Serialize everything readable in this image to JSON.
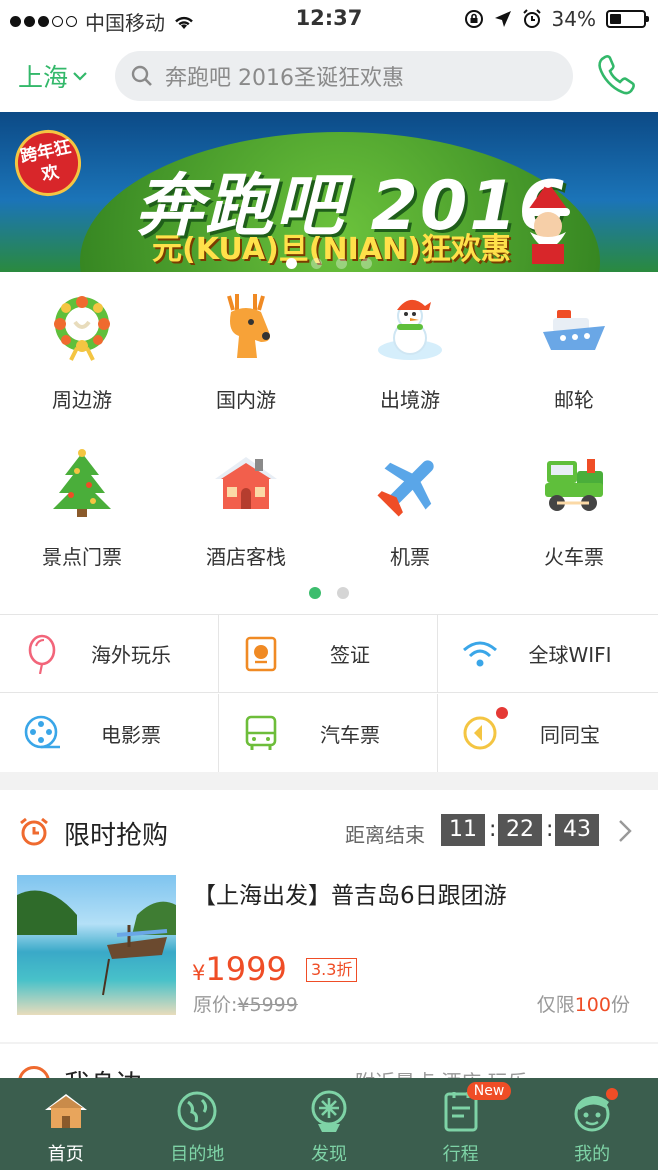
{
  "status_bar": {
    "carrier": "中国移动",
    "time": "12:37",
    "battery": "34%",
    "battery_level": 0.34
  },
  "header": {
    "city": "上海",
    "search_placeholder": "奔跑吧 2016圣诞狂欢惠"
  },
  "banner": {
    "badge": "跨年狂欢",
    "title": "奔跑吧 2016",
    "subtitle": "元(KUA)旦(NIAN)狂欢惠",
    "page_count": 4,
    "active_page": 1
  },
  "grid": {
    "items": [
      {
        "label": "周边游",
        "icon": "wreath-icon"
      },
      {
        "label": "国内游",
        "icon": "deer-icon"
      },
      {
        "label": "出境游",
        "icon": "snowman-icon"
      },
      {
        "label": "邮轮",
        "icon": "cruise-ship-icon"
      },
      {
        "label": "景点门票",
        "icon": "christmas-tree-icon"
      },
      {
        "label": "酒店客栈",
        "icon": "house-icon"
      },
      {
        "label": "机票",
        "icon": "airplane-icon"
      },
      {
        "label": "火车票",
        "icon": "train-icon"
      }
    ],
    "page_count": 2,
    "active_page": 1
  },
  "services": [
    {
      "label": "海外玩乐",
      "icon": "balloon-icon"
    },
    {
      "label": "签证",
      "icon": "passport-icon"
    },
    {
      "label": "全球WIFI",
      "icon": "wifi-icon"
    },
    {
      "label": "电影票",
      "icon": "film-reel-icon"
    },
    {
      "label": "汽车票",
      "icon": "bus-icon"
    },
    {
      "label": "同同宝",
      "icon": "wallet-icon"
    }
  ],
  "flash_sale": {
    "title": "限时抢购",
    "end_label": "距离结束",
    "hours": "11",
    "minutes": "22",
    "seconds": "43",
    "product_title": "【上海出发】普吉岛6日跟团游",
    "currency": "¥",
    "price": "1999",
    "discount": "3.3折",
    "orig_label": "原价:",
    "orig_price": "¥5999",
    "limit_prefix": "仅限",
    "limit_count": "100",
    "limit_suffix": "份"
  },
  "nearby": {
    "title": "我身边",
    "links": "附近景点  酒店  玩乐"
  },
  "tabbar": [
    {
      "label": "首页",
      "icon": "home-icon",
      "active": true
    },
    {
      "label": "目的地",
      "icon": "globe-icon"
    },
    {
      "label": "发现",
      "icon": "discover-icon"
    },
    {
      "label": "行程",
      "icon": "itinerary-icon",
      "badge": "New"
    },
    {
      "label": "我的",
      "icon": "profile-icon"
    }
  ],
  "colors": {
    "accent": "#33b86a",
    "price": "#ef4d26",
    "tabbar": "#3b5e4e"
  }
}
